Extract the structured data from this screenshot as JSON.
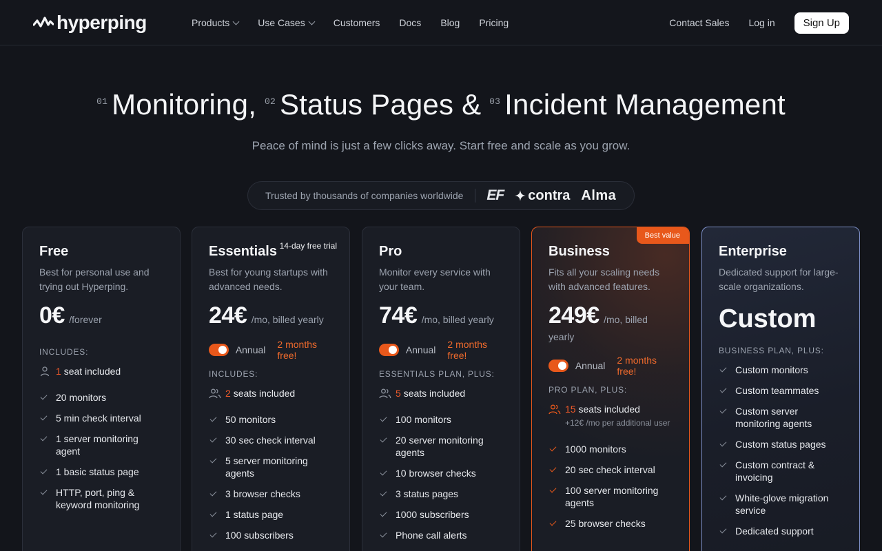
{
  "nav": {
    "logo_text": "hyperping",
    "links": [
      "Products",
      "Use Cases",
      "Customers",
      "Docs",
      "Blog",
      "Pricing"
    ],
    "contact_sales": "Contact Sales",
    "log_in": "Log in",
    "sign_up": "Sign Up"
  },
  "hero": {
    "num1": "01",
    "part1": "Monitoring,",
    "num2": "02",
    "part2": "Status Pages &",
    "num3": "03",
    "part3": "Incident Management",
    "subtitle": "Peace of mind is just a few clicks away. Start free and scale as you grow."
  },
  "trusted": {
    "text": "Trusted by thousands of companies worldwide",
    "brands": [
      "EF",
      "contra",
      "Alma"
    ]
  },
  "toggle": {
    "label": "Annual",
    "promo": "2 months free!"
  },
  "plans": {
    "free": {
      "name": "Free",
      "desc": "Best for personal use and trying out Hyperping.",
      "price": "0€",
      "per": "/forever",
      "section": "INCLUDES:",
      "seat_count": "1",
      "seat_text": "seat included",
      "features": [
        "20 monitors",
        "5 min check interval",
        "1 server monitoring agent",
        "1 basic status page",
        "HTTP, port, ping & keyword monitoring"
      ]
    },
    "essentials": {
      "name": "Essentials",
      "badge": "14-day free trial",
      "desc": "Best for young startups with advanced needs.",
      "price": "24€",
      "per": "/mo, billed yearly",
      "section": "INCLUDES:",
      "seat_count": "2",
      "seat_text": "seats included",
      "features": [
        "50 monitors",
        "30 sec check interval",
        "5 server monitoring agents",
        "3 browser checks",
        "1 status page",
        "100 subscribers"
      ]
    },
    "pro": {
      "name": "Pro",
      "desc": "Monitor every service with your team.",
      "price": "74€",
      "per": "/mo, billed yearly",
      "section": "ESSENTIALS PLAN, PLUS:",
      "seat_count": "5",
      "seat_text": "seats included",
      "features": [
        "100 monitors",
        "20 server monitoring agents",
        "10 browser checks",
        "3 status pages",
        "1000 subscribers",
        "Phone call alerts"
      ]
    },
    "business": {
      "name": "Business",
      "badge": "Best value",
      "desc": "Fits all your scaling needs with advanced features.",
      "price": "249€",
      "per": "/mo, billed yearly",
      "section": "PRO PLAN, PLUS:",
      "seat_count": "15",
      "seat_text": "seats included",
      "seat_note": "+12€ /mo per additional user",
      "features": [
        "1000 monitors",
        "20 sec check interval",
        "100 server monitoring agents",
        "25 browser checks"
      ]
    },
    "enterprise": {
      "name": "Enterprise",
      "desc": "Dedicated support for large-scale organizations.",
      "price": "Custom",
      "section": "BUSINESS PLAN, PLUS:",
      "features": [
        "Custom monitors",
        "Custom teammates",
        "Custom server monitoring agents",
        "Custom status pages",
        "Custom contract & invoicing",
        "White-glove migration service",
        "Dedicated support"
      ]
    }
  },
  "colors": {
    "accent": "#e8581b",
    "background": "#13151b",
    "card": "#1a1d25",
    "enterprise_border": "#7d8fc6"
  }
}
